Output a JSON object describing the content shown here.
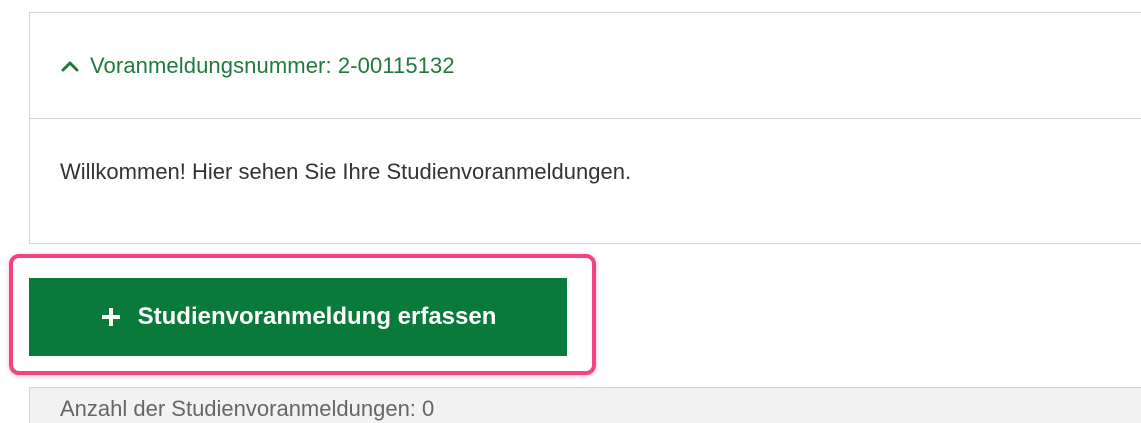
{
  "panel": {
    "title": "Voranmeldungsnummer: 2-00115132",
    "expanded_icon": "chevron-up-icon",
    "body_text": "Willkommen! Hier sehen Sie Ihre Studienvoranmeldungen."
  },
  "actions": {
    "add_label": "Studienvoranmeldung erfassen",
    "add_icon": "plus-icon"
  },
  "summary": {
    "count_text": "Anzahl der Studienvoranmeldungen: 0"
  },
  "colors": {
    "accent_green": "#0a7a3b",
    "title_green": "#1f7a3c",
    "highlight_pink": "#f0457a"
  }
}
